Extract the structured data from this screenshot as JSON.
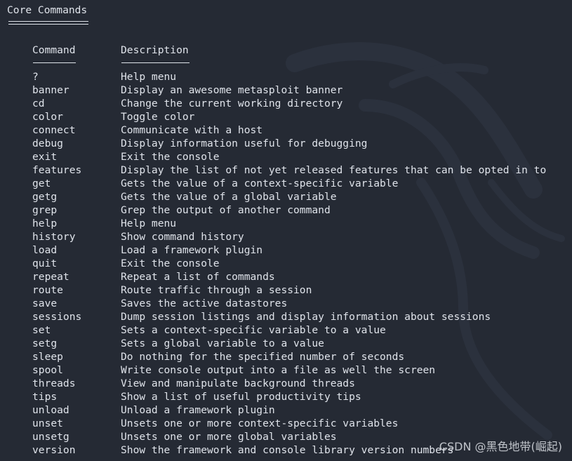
{
  "section": {
    "title": "Core Commands"
  },
  "table": {
    "headers": {
      "command": "Command",
      "description": "Description"
    },
    "rows": [
      {
        "command": "?",
        "description": "Help menu"
      },
      {
        "command": "banner",
        "description": "Display an awesome metasploit banner"
      },
      {
        "command": "cd",
        "description": "Change the current working directory"
      },
      {
        "command": "color",
        "description": "Toggle color"
      },
      {
        "command": "connect",
        "description": "Communicate with a host"
      },
      {
        "command": "debug",
        "description": "Display information useful for debugging"
      },
      {
        "command": "exit",
        "description": "Exit the console"
      },
      {
        "command": "features",
        "description": "Display the list of not yet released features that can be opted in to"
      },
      {
        "command": "get",
        "description": "Gets the value of a context-specific variable"
      },
      {
        "command": "getg",
        "description": "Gets the value of a global variable"
      },
      {
        "command": "grep",
        "description": "Grep the output of another command"
      },
      {
        "command": "help",
        "description": "Help menu"
      },
      {
        "command": "history",
        "description": "Show command history"
      },
      {
        "command": "load",
        "description": "Load a framework plugin"
      },
      {
        "command": "quit",
        "description": "Exit the console"
      },
      {
        "command": "repeat",
        "description": "Repeat a list of commands"
      },
      {
        "command": "route",
        "description": "Route traffic through a session"
      },
      {
        "command": "save",
        "description": "Saves the active datastores"
      },
      {
        "command": "sessions",
        "description": "Dump session listings and display information about sessions"
      },
      {
        "command": "set",
        "description": "Sets a context-specific variable to a value"
      },
      {
        "command": "setg",
        "description": "Sets a global variable to a value"
      },
      {
        "command": "sleep",
        "description": "Do nothing for the specified number of seconds"
      },
      {
        "command": "spool",
        "description": "Write console output into a file as well the screen"
      },
      {
        "command": "threads",
        "description": "View and manipulate background threads"
      },
      {
        "command": "tips",
        "description": "Show a list of useful productivity tips"
      },
      {
        "command": "unload",
        "description": "Unload a framework plugin"
      },
      {
        "command": "unset",
        "description": "Unsets one or more context-specific variables"
      },
      {
        "command": "unsetg",
        "description": "Unsets one or more global variables"
      },
      {
        "command": "version",
        "description": "Show the framework and console library version numbers"
      }
    ]
  },
  "watermark": {
    "text": "CSDN @黑色地带(崛起)"
  },
  "colors": {
    "background": "#252a34",
    "text": "#dfe3ea"
  },
  "icons": {
    "background": "kali-dragon-icon"
  }
}
